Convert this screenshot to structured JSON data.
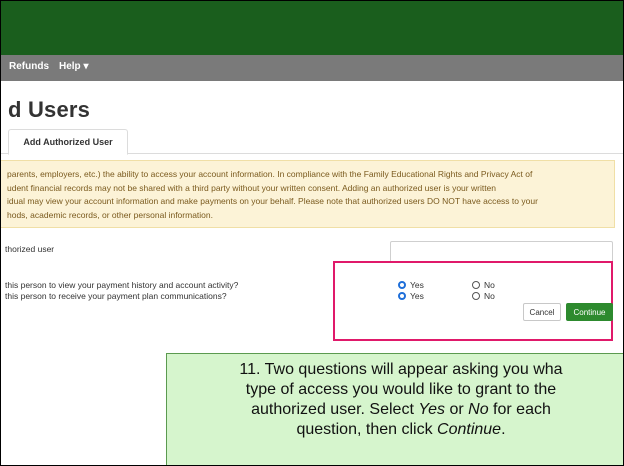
{
  "nav": {
    "refunds": "Refunds",
    "help": "Help ▾"
  },
  "page": {
    "title": "d Users"
  },
  "tabs": [
    {
      "label": "Add Authorized User"
    }
  ],
  "notice": {
    "lines": [
      "parents, employers, etc.) the ability to access your account information. In compliance with the Family Educational Rights and Privacy Act of",
      "udent financial records may not be shared with a third party without your written consent. Adding an authorized user is your written",
      "idual may view your account information and make payments on your behalf. Please note that authorized users DO NOT have access to your",
      "hods, academic records, or other personal information."
    ]
  },
  "form": {
    "email_label": "thorized user",
    "email_value": "",
    "q1": "this person to view your payment history and account activity?",
    "q2": "this person to receive your payment plan communications?",
    "yes": "Yes",
    "no": "No",
    "q1_selected": "Yes",
    "q2_selected": "Yes"
  },
  "buttons": {
    "cancel": "Cancel",
    "continue": "Continue"
  },
  "callout": {
    "line1": "11. Two questions will appear asking you wha",
    "line2": "type of access you would like to grant to the",
    "line3_pre": "authorized user. Select ",
    "yes": "Yes",
    "or": " or ",
    "no": "No",
    "line3_post": " for each",
    "line4_pre": "question, then click ",
    "continue": "Continue",
    "line4_post": "."
  },
  "colors": {
    "header": "#1a5e1d",
    "nav": "#7a7a7a",
    "continue": "#2d8a2e",
    "highlight": "#e0196a",
    "callout": "#d6f5cd"
  }
}
